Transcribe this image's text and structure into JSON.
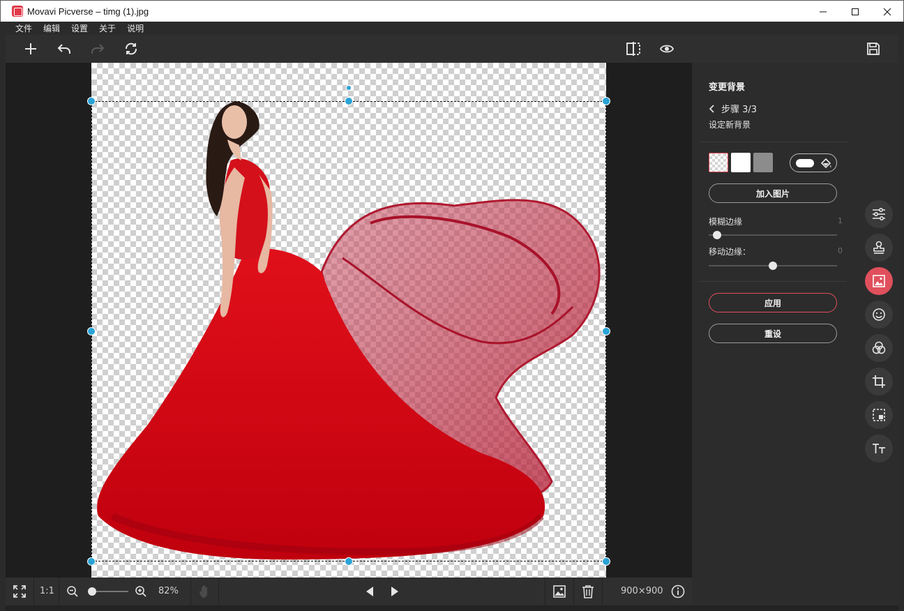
{
  "window": {
    "title": "Movavi Picverse – timg (1).jpg",
    "minimize": "—",
    "maximize": "☐",
    "close": "✕"
  },
  "menu": [
    "文件",
    "编辑",
    "设置",
    "关于",
    "说明"
  ],
  "toolbar": {
    "left_icons": [
      "add-icon",
      "undo-icon",
      "redo-icon",
      "rotate-icon"
    ],
    "right_icons": [
      "compare-icon",
      "preview-eye-icon",
      "save-icon"
    ]
  },
  "panel": {
    "title": "变更背景",
    "step": "步骤 3/3",
    "subtitle": "设定新背景",
    "add_image_label": "加入图片",
    "blur_label": "模糊边缘",
    "blur_value": "1",
    "shift_label": "移动边缘：",
    "shift_value": "0",
    "apply_label": "应用",
    "reset_label": "重设"
  },
  "bottom": {
    "ratio_label": "1:1",
    "zoom_label": "82%",
    "size_label": "900×900"
  },
  "colors": {
    "accent": "#e0505c",
    "handle": "#2aa3d6"
  },
  "tools": [
    "adjust-icon",
    "stamp-icon",
    "background-icon",
    "smile-icon",
    "filters-icon",
    "crop-icon",
    "selection-icon",
    "text-icon"
  ]
}
